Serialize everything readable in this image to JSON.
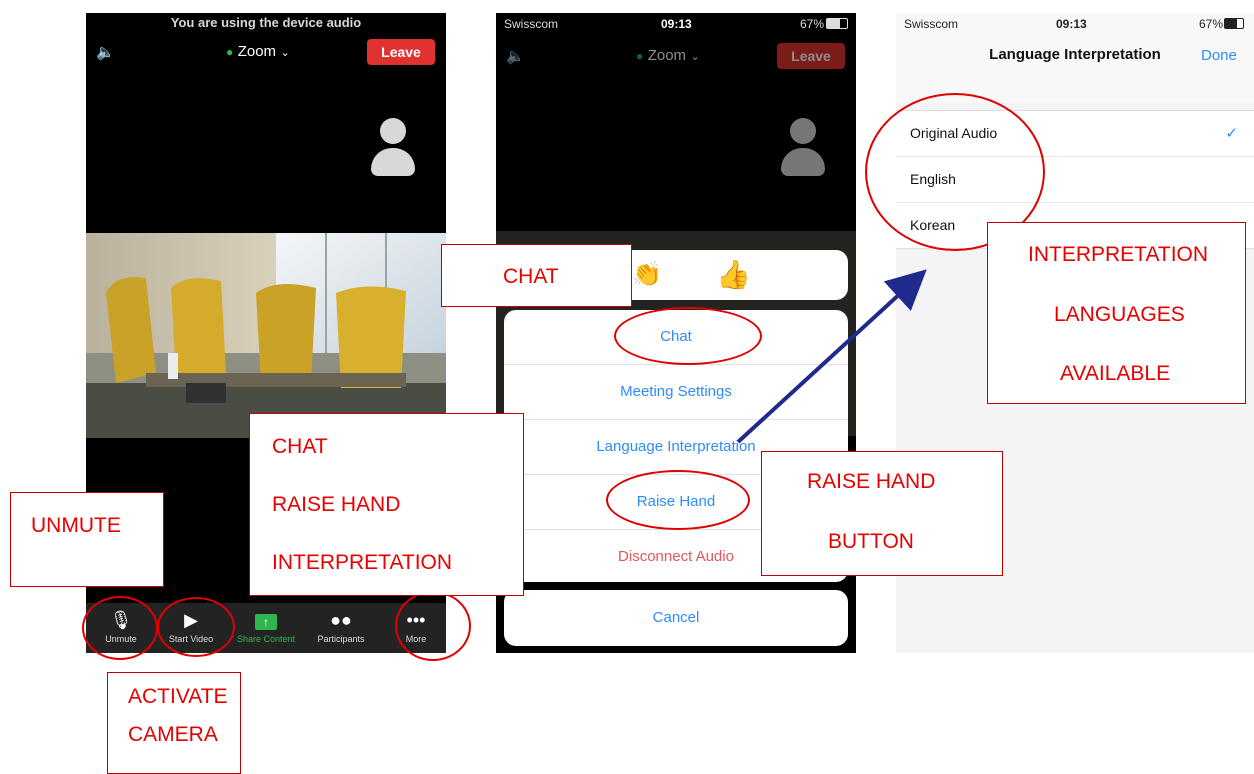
{
  "phone1": {
    "notice": "You are using the device audio",
    "meeting_title": "Zoom",
    "leave_label": "Leave",
    "toolbar": [
      {
        "label": "Unmute",
        "icon": "mic-muted-icon"
      },
      {
        "label": "Start Video",
        "icon": "video-off-icon"
      },
      {
        "label": "Share Content",
        "icon": "share-icon"
      },
      {
        "label": "Participants",
        "icon": "participants-icon"
      },
      {
        "label": "More",
        "icon": "more-icon"
      }
    ]
  },
  "phone2": {
    "carrier": "Swisscom",
    "time": "09:13",
    "battery": "67%",
    "meeting_title": "Zoom",
    "leave_label": "Leave",
    "reaction": "👍",
    "menu": {
      "chat": "Chat",
      "meeting_settings": "Meeting Settings",
      "language_interpretation": "Language Interpretation",
      "raise_hand": "Raise Hand",
      "disconnect_audio": "Disconnect Audio",
      "cancel": "Cancel"
    }
  },
  "phone3": {
    "carrier": "Swisscom",
    "time": "09:13",
    "battery": "67%",
    "title": "Language Interpretation",
    "done_label": "Done",
    "languages": [
      {
        "label": "Original Audio",
        "selected": true
      },
      {
        "label": "English",
        "selected": false
      },
      {
        "label": "Korean",
        "selected": false
      }
    ]
  },
  "annotations": {
    "chat_label": "CHAT",
    "more_menu": [
      "CHAT",
      "RAISE HAND",
      "INTERPRETATION"
    ],
    "unmute": "UNMUTE",
    "activate_camera": [
      "ACTIVATE",
      "CAMERA"
    ],
    "raise_hand_button": [
      "RAISE HAND",
      "BUTTON"
    ],
    "interpretation_languages": [
      "INTERPRETATION",
      "LANGUAGES",
      "AVAILABLE"
    ]
  },
  "colors": {
    "accent_blue": "#2d8cff",
    "leave_red": "#e0332f",
    "annotation_red": "#e60000",
    "arrow_navy": "#1f2a8c"
  }
}
